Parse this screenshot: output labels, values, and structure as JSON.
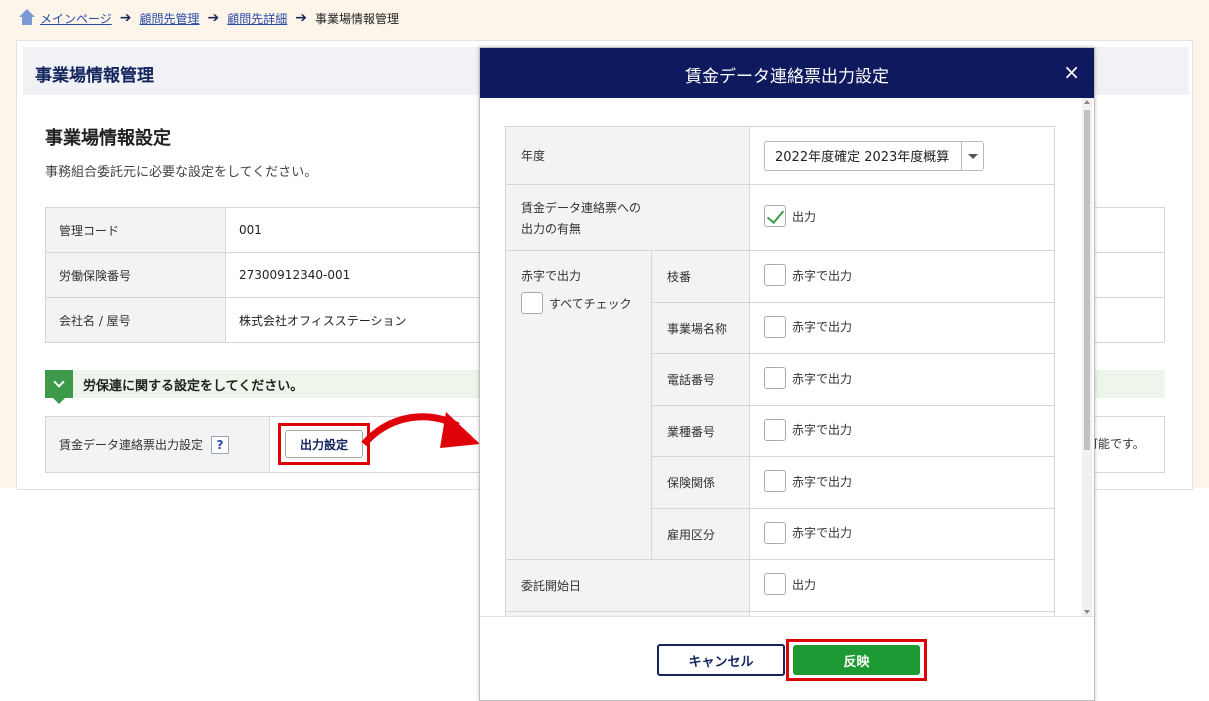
{
  "breadcrumb": {
    "items": [
      "メインページ",
      "顧問先管理",
      "顧問先詳細"
    ],
    "current": "事業場情報管理"
  },
  "panel": {
    "title": "事業場情報管理",
    "section_title": "事業場情報設定",
    "section_desc": "事務組合委託元に必要な設定をしてください。",
    "info_rows": [
      {
        "label": "管理コード",
        "value": "001"
      },
      {
        "label": "労働保険番号",
        "value": "27300912340-001"
      },
      {
        "label": "会社名 / 屋号",
        "value": "株式会社オフィスステーション"
      }
    ],
    "notice": "労保連に関する設定をしてください。",
    "output_row": {
      "label": "賃金データ連絡票出力設定",
      "help": "?",
      "button": "出力設定",
      "tail_text": "可能です。"
    }
  },
  "modal": {
    "title": "賃金データ連絡票出力設定",
    "close": "×",
    "year_label": "年度",
    "year_value": "2022年度確定 2023年度概算",
    "output_label_line1": "賃金データ連絡票への",
    "output_label_line2": "出力の有無",
    "output_option": "出力",
    "red_label": "赤字で出力",
    "check_all": "すべてチェック",
    "red_rows": [
      {
        "label": "枝番",
        "option": "赤字で出力"
      },
      {
        "label": "事業場名称",
        "option": "赤字で出力"
      },
      {
        "label": "電話番号",
        "option": "赤字で出力"
      },
      {
        "label": "業種番号",
        "option": "赤字で出力"
      },
      {
        "label": "保険関係",
        "option": "赤字で出力"
      },
      {
        "label": "雇用区分",
        "option": "赤字で出力"
      }
    ],
    "start_label": "委託開始日",
    "start_option": "出力",
    "cancel": "キャンセル",
    "apply": "反映"
  },
  "colors": {
    "modal_header": "#0f1a5e",
    "apply_button": "#1e9a34",
    "highlight": "#e0000a"
  }
}
